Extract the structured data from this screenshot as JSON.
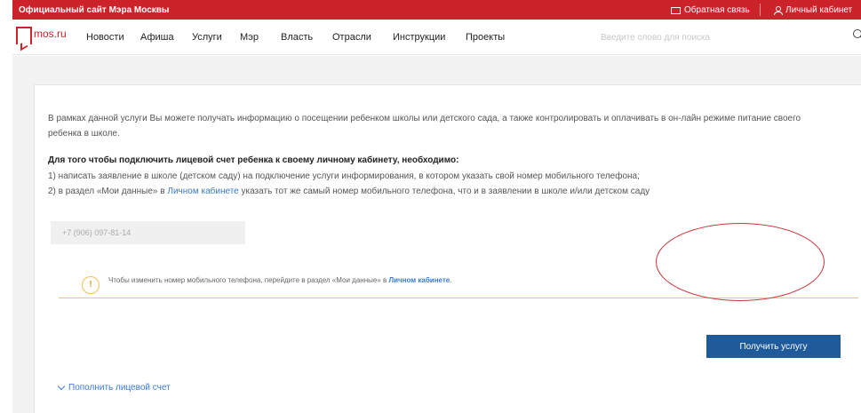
{
  "topbar": {
    "site_title": "Официальный сайт Мэра Москвы",
    "feedback_label": "Обратная связь",
    "cabinet_label": "Личный кабинет",
    "color": "#cc2229"
  },
  "nav": {
    "logo_text": "mos.ru",
    "items": [
      "Новости",
      "Афиша",
      "Услуги",
      "Мэр",
      "Власть",
      "Отрасли",
      "Инструкции",
      "Проекты"
    ],
    "search_placeholder": "Введите слово для поиска"
  },
  "content": {
    "intro": "В рамках данной услуги Вы можете получать информацию о посещении ребенком школы или детского сада, а также контролировать и оплачивать в он-лайн режиме питание своего ребенка в школе.",
    "how_title": "Для того чтобы подключить лицевой счет ребенка к своему личному кабинету, необходимо:",
    "step1": "1) написать заявление в школе (детском саду) на подключение услуги информирования, в котором указать свой номер мобильного телефона;",
    "step2_before": "2) в раздел «Мои данные» в ",
    "step2_link": "Личном кабинете",
    "step2_after": " указать тот же самый номер мобильного телефона, что и в заявлении в школе и/или детском саду",
    "phone_value": "+7 (906) 097-81-14",
    "notice_before": "Чтобы изменить номер мобильного телефона, перейдите в раздел «Мои данные» в ",
    "notice_link": "Личном кабинете",
    "notice_after": ".",
    "warn_symbol": "!",
    "get_service_label": "Получить услугу",
    "topup_label": "Пополнить лицевой счет"
  },
  "colors": {
    "accent_red": "#cc2229",
    "button_blue": "#1f5b9a",
    "link_blue": "#3a7bc8",
    "notice_border": "#f0c27a"
  }
}
